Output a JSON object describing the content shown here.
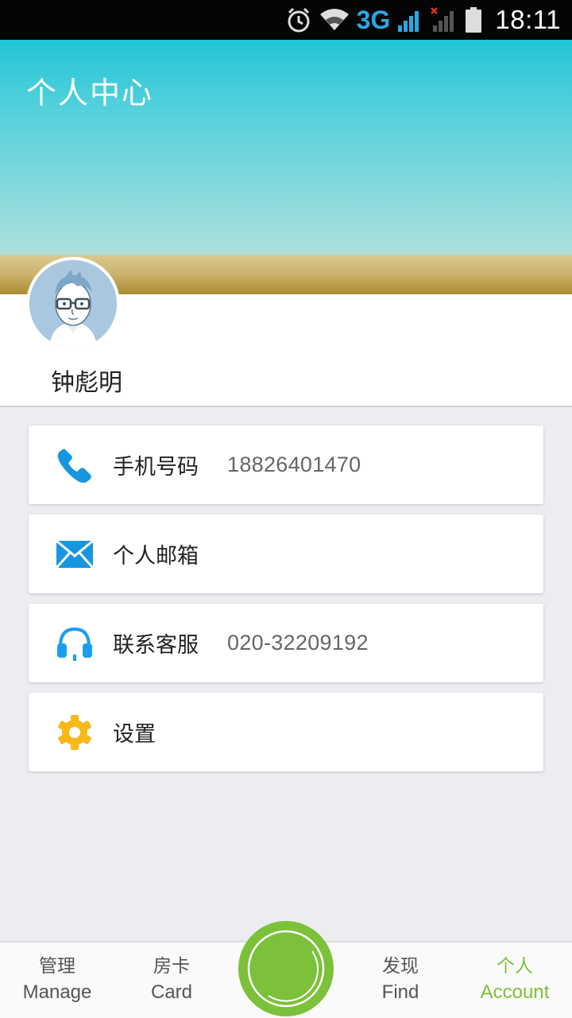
{
  "status_bar": {
    "network": "3G",
    "time": "18:11",
    "icons": [
      "alarm-icon",
      "wifi-icon",
      "signal-icon",
      "signal-no-service-icon",
      "battery-icon"
    ]
  },
  "header": {
    "title": "个人中心"
  },
  "profile": {
    "avatar_icon": "avatar-cartoon-glasses",
    "name": "钟彪明"
  },
  "menu": [
    {
      "icon": "phone-icon",
      "label": "手机号码",
      "value": "18826401470",
      "color": "#1796e0"
    },
    {
      "icon": "mail-icon",
      "label": "个人邮箱",
      "value": "",
      "color": "#1796e0"
    },
    {
      "icon": "headset-icon",
      "label": "联系客服",
      "value": "020-32209192",
      "color": "#1a9ff0"
    },
    {
      "icon": "gear-icon",
      "label": "设置",
      "value": "",
      "color": "#f7b916"
    }
  ],
  "bottom_nav": {
    "items": [
      {
        "cn": "管理",
        "en": "Manage",
        "active": false
      },
      {
        "cn": "房卡",
        "en": "Card",
        "active": false
      },
      {
        "cn": "发现",
        "en": "Find",
        "active": false
      },
      {
        "cn": "个人",
        "en": "Account",
        "active": true
      }
    ],
    "accent": "#7cc13a"
  }
}
